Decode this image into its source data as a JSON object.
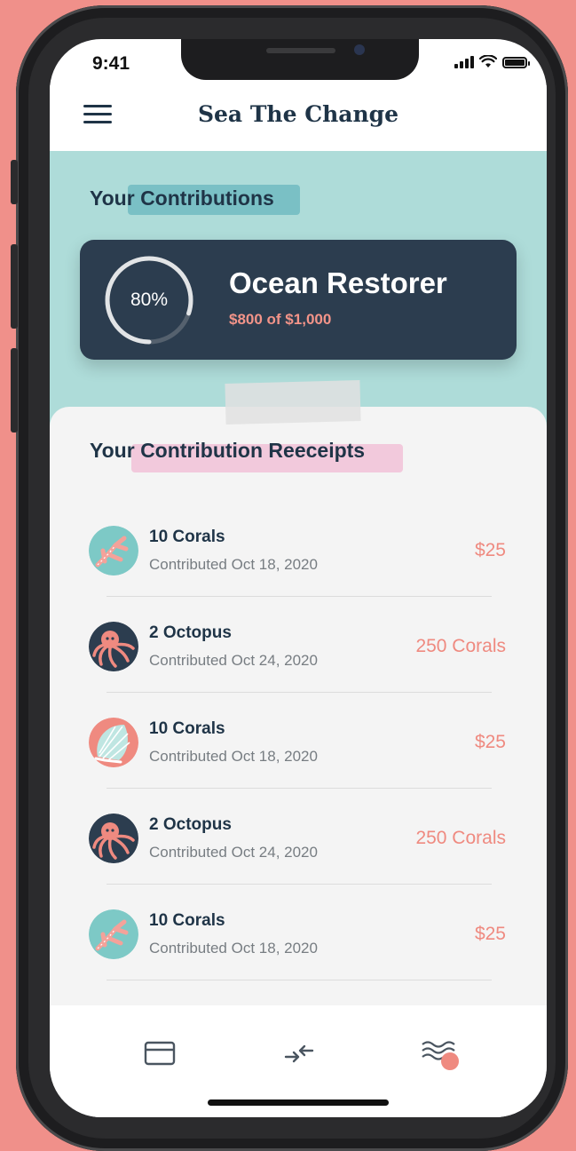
{
  "status_bar": {
    "time": "9:41"
  },
  "header": {
    "title": "Sea The Change",
    "menu_icon": "menu-icon"
  },
  "contributions": {
    "heading": "Your Contributions",
    "level": {
      "progress_label": "80%",
      "progress_fraction": 0.8,
      "name": "Ocean Restorer",
      "amount_text": "$800 of $1,000"
    }
  },
  "receipts": {
    "heading": "Your Contribution Reeceipts",
    "items": [
      {
        "title": "10 Corals",
        "date": "Contributed Oct 18, 2020",
        "value": "$25",
        "icon": "coral-icon"
      },
      {
        "title": "2 Octopus",
        "date": "Contributed Oct 24, 2020",
        "value": "250 Corals",
        "icon": "octopus-icon"
      },
      {
        "title": "10 Corals",
        "date": "Contributed Oct 18, 2020",
        "value": "$25",
        "icon": "shell-icon"
      },
      {
        "title": "2 Octopus",
        "date": "Contributed Oct 24, 2020",
        "value": "250 Corals",
        "icon": "octopus-icon"
      },
      {
        "title": "10 Corals",
        "date": "Contributed Oct 18, 2020",
        "value": "$25",
        "icon": "coral-icon"
      }
    ]
  },
  "bottom_nav": {
    "items": [
      "card-icon",
      "transfer-icon",
      "waves-icon"
    ]
  },
  "colors": {
    "teal": "#aedcd9",
    "navy": "#2c3d4f",
    "coral": "#ef8a80",
    "background": "#f0908a"
  }
}
